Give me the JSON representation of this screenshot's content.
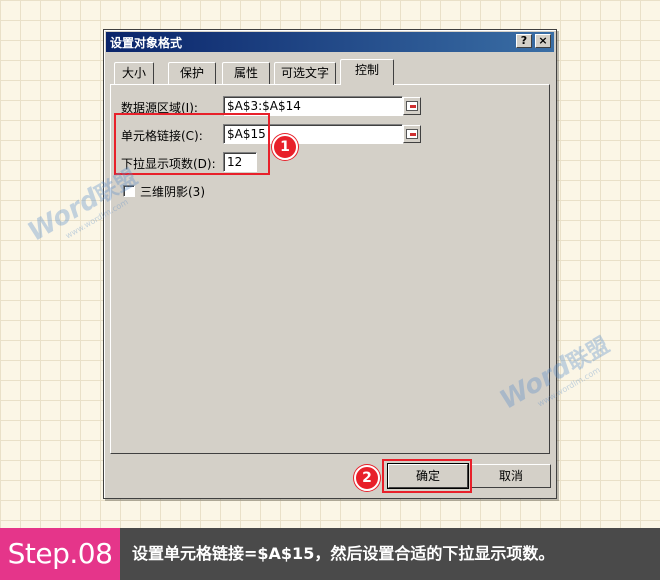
{
  "dialog": {
    "title": "设置对象格式",
    "help_btn": "?",
    "close_btn": "×",
    "tabs": [
      {
        "label": "大小"
      },
      {
        "label": "保护"
      },
      {
        "label": "属性"
      },
      {
        "label": "可选文字"
      },
      {
        "label": "控制",
        "active": true
      }
    ],
    "fields": {
      "source_range": {
        "label": "数据源区域(I):",
        "value": "$A$3:$A$14"
      },
      "cell_link": {
        "label": "单元格链接(C):",
        "value": "$A$15"
      },
      "dropdown_lines": {
        "label": "下拉显示项数(D):",
        "value": "12"
      }
    },
    "shading": {
      "label": "三维阴影(3)",
      "checked": false
    },
    "ok_label": "确定",
    "cancel_label": "取消"
  },
  "annotations": {
    "badge1": "1",
    "badge2": "2",
    "color": "#e8202a"
  },
  "watermark": {
    "brand": "Word",
    "cn": "联盟",
    "url": "www.wordlm.com"
  },
  "footer": {
    "step": "Step.08",
    "caption": "设置单元格链接=$A$15，然后设置合适的下拉显示项数。",
    "step_color": "#e5358a",
    "bar_color": "#4a4a4a"
  }
}
